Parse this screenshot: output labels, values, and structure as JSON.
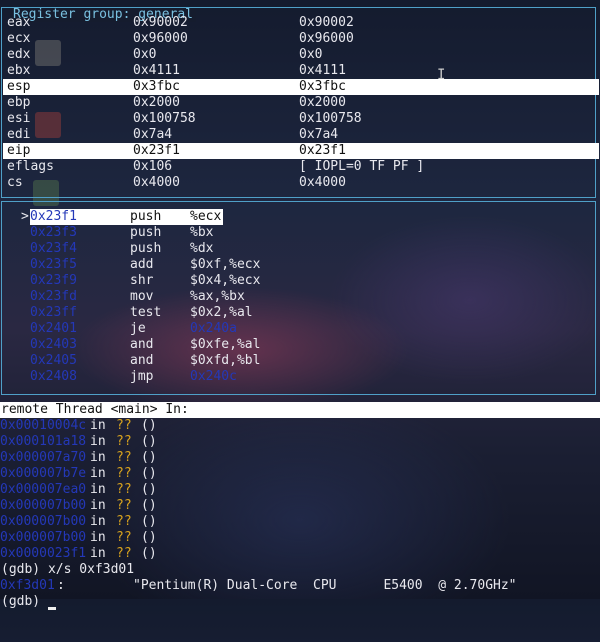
{
  "registers": {
    "title": "Register group: general",
    "rows": [
      {
        "name": "eax",
        "hex": "0x90002",
        "natural": "0x90002",
        "highlight": false
      },
      {
        "name": "ecx",
        "hex": "0x96000",
        "natural": "0x96000",
        "highlight": false
      },
      {
        "name": "edx",
        "hex": "0x0",
        "natural": "0x0",
        "highlight": false
      },
      {
        "name": "ebx",
        "hex": "0x4111",
        "natural": "0x4111",
        "highlight": false
      },
      {
        "name": "esp",
        "hex": "0x3fbc",
        "natural": "0x3fbc",
        "highlight": true
      },
      {
        "name": "ebp",
        "hex": "0x2000",
        "natural": "0x2000",
        "highlight": false
      },
      {
        "name": "esi",
        "hex": "0x100758",
        "natural": "0x100758",
        "highlight": false
      },
      {
        "name": "edi",
        "hex": "0x7a4",
        "natural": "0x7a4",
        "highlight": false
      },
      {
        "name": "eip",
        "hex": "0x23f1",
        "natural": "0x23f1",
        "highlight": true
      },
      {
        "name": "eflags",
        "hex": "0x106",
        "natural": "[ IOPL=0 TF PF ]",
        "highlight": false
      },
      {
        "name": "cs",
        "hex": "0x4000",
        "natural": "0x4000",
        "highlight": false
      }
    ]
  },
  "assembly": {
    "current_marker": ">",
    "rows": [
      {
        "addr": "0x23f1",
        "op": "push",
        "args": "%ecx",
        "target": "",
        "current": true
      },
      {
        "addr": "0x23f3",
        "op": "push",
        "args": "%bx",
        "target": "",
        "current": false
      },
      {
        "addr": "0x23f4",
        "op": "push",
        "args": "%dx",
        "target": "",
        "current": false
      },
      {
        "addr": "0x23f5",
        "op": "add",
        "args": "$0xf,%ecx",
        "target": "",
        "current": false
      },
      {
        "addr": "0x23f9",
        "op": "shr",
        "args": "$0x4,%ecx",
        "target": "",
        "current": false
      },
      {
        "addr": "0x23fd",
        "op": "mov",
        "args": "%ax,%bx",
        "target": "",
        "current": false
      },
      {
        "addr": "0x23ff",
        "op": "test",
        "args": "$0x2,%al",
        "target": "",
        "current": false
      },
      {
        "addr": "0x2401",
        "op": "je",
        "args": "",
        "target": "0x240a",
        "current": false
      },
      {
        "addr": "0x2403",
        "op": "and",
        "args": "$0xfe,%al",
        "target": "",
        "current": false
      },
      {
        "addr": "0x2405",
        "op": "and",
        "args": "$0xfd,%bl",
        "target": "",
        "current": false
      },
      {
        "addr": "0x2408",
        "op": "jmp",
        "args": "",
        "target": "0x240c",
        "current": false
      }
    ]
  },
  "status_line": "remote Thread <main> In:",
  "backtrace": [
    {
      "addr": "0x00010004c",
      "in": "in",
      "func": "??",
      "parens": "()"
    },
    {
      "addr": "0x000101a18",
      "in": "in",
      "func": "??",
      "parens": "()"
    },
    {
      "addr": "0x000007a70",
      "in": "in",
      "func": "??",
      "parens": "()"
    },
    {
      "addr": "0x000007b7e",
      "in": "in",
      "func": "??",
      "parens": "()"
    },
    {
      "addr": "0x000007ea0",
      "in": "in",
      "func": "??",
      "parens": "()"
    },
    {
      "addr": "0x000007b00",
      "in": "in",
      "func": "??",
      "parens": "()"
    },
    {
      "addr": "0x000007b00",
      "in": "in",
      "func": "??",
      "parens": "()"
    },
    {
      "addr": "0x000007b00",
      "in": "in",
      "func": "??",
      "parens": "()"
    },
    {
      "addr": "0x0000023f1",
      "in": "in",
      "func": "??",
      "parens": "()"
    }
  ],
  "gdb": {
    "prompt_command": "(gdb) x/s 0xf3d01",
    "mem_addr": "0xf3d01",
    "mem_colon": ":",
    "mem_string": "\"Pentium(R) Dual-Core  CPU      E5400  @ 2.70GHz\"",
    "next_prompt": "(gdb) "
  },
  "colors": {
    "address": "#2438b8",
    "border": "#4fa0c8",
    "unknown_func": "#d7a21e"
  }
}
